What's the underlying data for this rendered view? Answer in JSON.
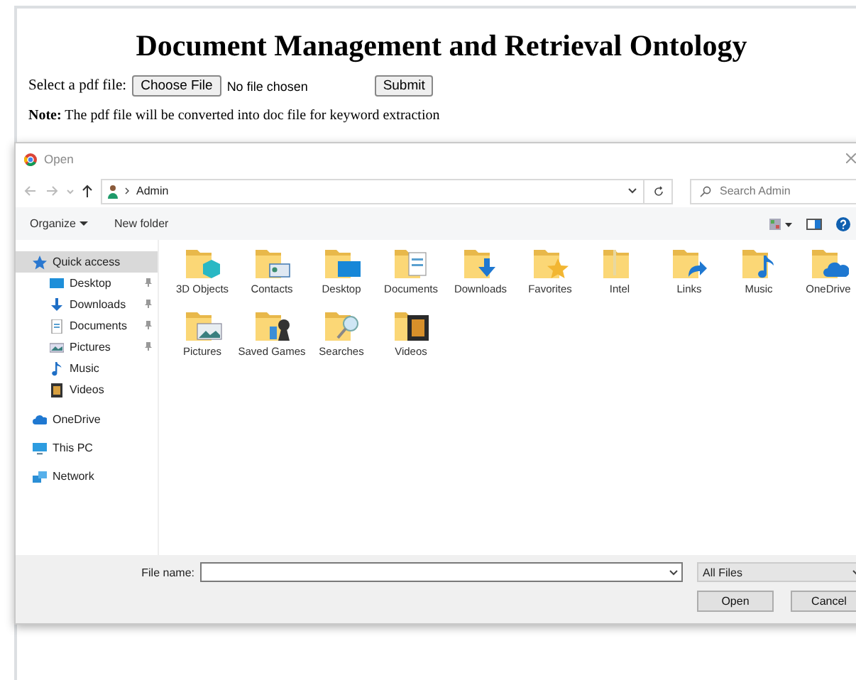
{
  "page": {
    "title": "Document Management and Retrieval Ontology",
    "upload_label": "Select a pdf file:",
    "choose_button": "Choose File",
    "file_status": "No file chosen",
    "submit_button": "Submit",
    "note": "**Note:** The pdf file will be converted into doc file for keyword extraction"
  },
  "dialog": {
    "title": "Open",
    "path": "Admin",
    "search": {
      "placeholder": "Search Admin"
    },
    "toolbar": [
      "Organize",
      "New folder"
    ],
    "sidebar": [
      {
        "label": "Quick access",
        "kind": "star",
        "selected": true,
        "children": [
          {
            "label": "Desktop",
            "kind": "desktop",
            "pinned": true
          },
          {
            "label": "Downloads",
            "kind": "download",
            "pinned": true
          },
          {
            "label": "Documents",
            "kind": "document",
            "pinned": true
          },
          {
            "label": "Pictures",
            "kind": "picture",
            "pinned": true
          },
          {
            "label": "Music",
            "kind": "music",
            "pinned": false
          },
          {
            "label": "Videos",
            "kind": "video",
            "pinned": false
          }
        ]
      },
      {
        "label": "OneDrive",
        "kind": "cloud",
        "selected": false
      },
      {
        "label": "This PC",
        "kind": "pc",
        "selected": false
      },
      {
        "label": "Network",
        "kind": "network",
        "selected": false
      }
    ],
    "folders": [
      {
        "name": "3D Objects",
        "kind": "cube"
      },
      {
        "name": "Contacts",
        "kind": "contact"
      },
      {
        "name": "Desktop",
        "kind": "desktop"
      },
      {
        "name": "Documents",
        "kind": "document"
      },
      {
        "name": "Downloads",
        "kind": "download"
      },
      {
        "name": "Favorites",
        "kind": "star"
      },
      {
        "name": "Intel",
        "kind": "plain"
      },
      {
        "name": "Links",
        "kind": "link"
      },
      {
        "name": "Music",
        "kind": "music"
      },
      {
        "name": "OneDrive",
        "kind": "cloud"
      },
      {
        "name": "Pictures",
        "kind": "picture"
      },
      {
        "name": "Saved Games",
        "kind": "games"
      },
      {
        "name": "Searches",
        "kind": "search"
      },
      {
        "name": "Videos",
        "kind": "video"
      }
    ],
    "file_name_label": "File name:",
    "file_type": "All Files",
    "open_button": "Open",
    "cancel_button": "Cancel"
  }
}
